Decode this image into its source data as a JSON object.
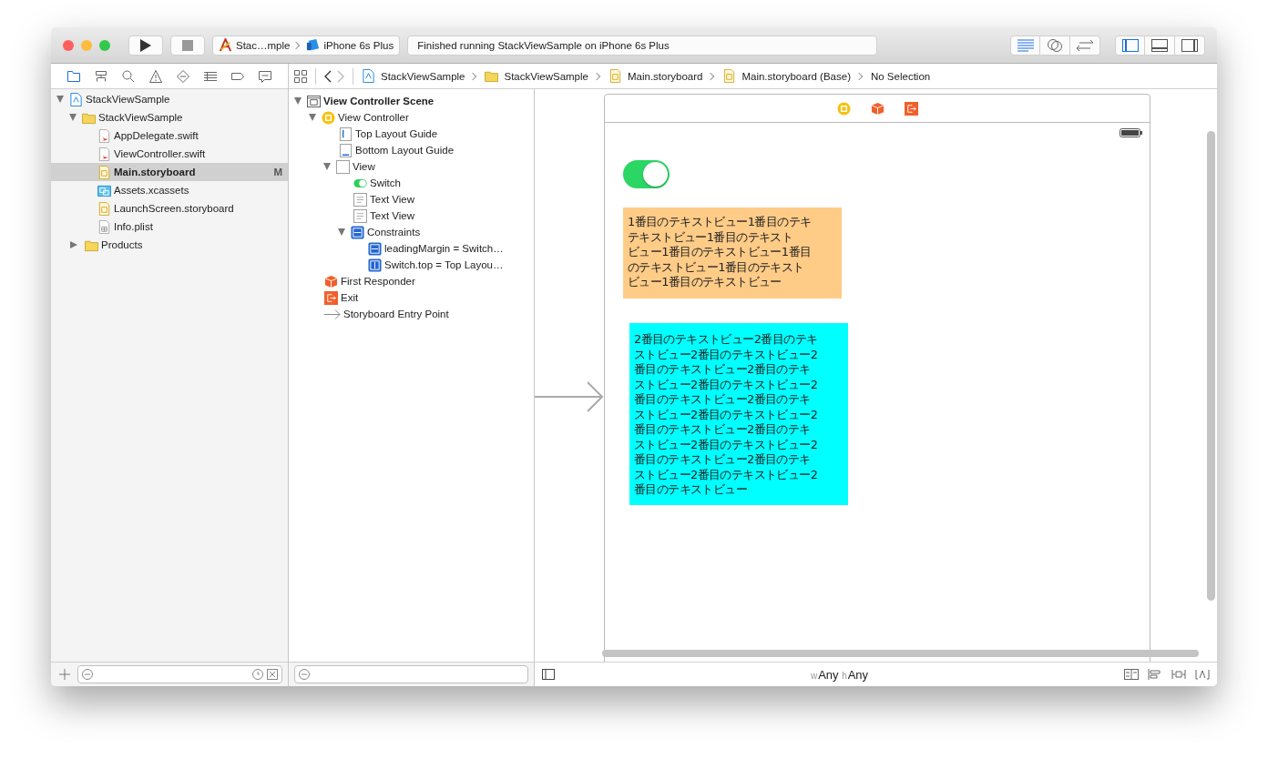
{
  "toolbar": {
    "scheme": {
      "target": "Stac…mple",
      "device": "iPhone 6s Plus"
    },
    "activity": "Finished running StackViewSample on iPhone 6s Plus",
    "editor_modes": [
      {
        "kind": "standard",
        "selected": true
      },
      {
        "kind": "assistant",
        "selected": false
      },
      {
        "kind": "version",
        "selected": false
      }
    ],
    "view_toggles": [
      {
        "kind": "navigator",
        "selected": true
      },
      {
        "kind": "debug",
        "selected": false
      },
      {
        "kind": "utilities",
        "selected": false
      }
    ]
  },
  "navigator_tabs": [
    {
      "kind": "folder",
      "selected": true
    },
    {
      "kind": "hierarchy",
      "selected": false
    },
    {
      "kind": "search",
      "selected": false
    },
    {
      "kind": "warning",
      "selected": false
    },
    {
      "kind": "test",
      "selected": false
    },
    {
      "kind": "debug",
      "selected": false
    },
    {
      "kind": "breakpoint",
      "selected": false
    },
    {
      "kind": "report",
      "selected": false
    }
  ],
  "jump_bar": {
    "back_enabled": true,
    "forward_enabled": false,
    "path": [
      {
        "kind": "project",
        "label": "StackViewSample"
      },
      {
        "kind": "folder",
        "label": "StackViewSample"
      },
      {
        "kind": "storyboard",
        "label": "Main.storyboard"
      },
      {
        "kind": "storyboard",
        "label": "Main.storyboard (Base)"
      },
      {
        "kind": "none",
        "label": "No Selection"
      }
    ]
  },
  "navigator": {
    "items": [
      {
        "kind": "project",
        "label": "StackViewSample",
        "selected": false,
        "expanded": true,
        "children": [
          {
            "kind": "folder",
            "label": "StackViewSample",
            "selected": false,
            "expanded": true,
            "children": [
              {
                "kind": "swift",
                "label": "AppDelegate.swift",
                "selected": false
              },
              {
                "kind": "swift",
                "label": "ViewController.swift",
                "selected": false
              },
              {
                "kind": "storyboard",
                "label": "Main.storyboard",
                "selected": true,
                "badge": "M"
              },
              {
                "kind": "assets",
                "label": "Assets.xcassets",
                "selected": false
              },
              {
                "kind": "storyboard",
                "label": "LaunchScreen.storyboard",
                "selected": false
              },
              {
                "kind": "plist",
                "label": "Info.plist",
                "selected": false
              }
            ]
          },
          {
            "kind": "folder",
            "label": "Products",
            "selected": false,
            "expanded": false
          }
        ]
      }
    ]
  },
  "outline": {
    "items": [
      {
        "kind": "scene",
        "label": "View Controller Scene",
        "expanded": true,
        "children": [
          {
            "kind": "controller",
            "label": "View Controller",
            "expanded": true,
            "children": [
              {
                "kind": "top_guide",
                "label": "Top Layout Guide"
              },
              {
                "kind": "bottom_guide",
                "label": "Bottom Layout Guide"
              },
              {
                "kind": "view",
                "label": "View",
                "expanded": true,
                "children": [
                  {
                    "kind": "switch",
                    "label": "Switch"
                  },
                  {
                    "kind": "textview",
                    "label": "Text View"
                  },
                  {
                    "kind": "textview",
                    "label": "Text View"
                  },
                  {
                    "kind": "constraints",
                    "label": "Constraints",
                    "expanded": true,
                    "children": [
                      {
                        "kind": "h_constraint",
                        "label": "leadingMargin = Switch…"
                      },
                      {
                        "kind": "v_constraint",
                        "label": "Switch.top = Top Layou…"
                      }
                    ]
                  }
                ]
              }
            ]
          },
          {
            "kind": "responder",
            "label": "First Responder"
          },
          {
            "kind": "exit",
            "label": "Exit"
          },
          {
            "kind": "entry",
            "label": "Storyboard Entry Point"
          }
        ]
      }
    ]
  },
  "canvas": {
    "scene_dock": [
      {
        "kind": "controller"
      },
      {
        "kind": "responder"
      },
      {
        "kind": "exit"
      }
    ],
    "switch": {
      "on": true
    },
    "text_views": [
      {
        "color": "#ffcc88",
        "lines": [
          "1番目のテキストビュー1番目のテキ",
          "テキストビュー1番目のテキスト",
          "ビュー1番目のテキストビュー1番目",
          "のテキストビュー1番目のテキスト",
          "ビュー1番目のテキストビュー"
        ]
      },
      {
        "color": "#00ffff",
        "lines": [
          "2番目のテキストビュー2番目のテキ",
          "ストビュー2番目のテキストビュー2",
          "番目のテキストビュー2番目のテキ",
          "ストビュー2番目のテキストビュー2",
          "番目のテキストビュー2番目のテキ",
          "ストビュー2番目のテキストビュー2",
          "番目のテキストビュー2番目のテキ",
          "ストビュー2番目のテキストビュー2",
          "番目のテキストビュー2番目のテキ",
          "ストビュー2番目のテキストビュー2",
          "番目のテキストビュー"
        ]
      }
    ]
  },
  "size_class": {
    "w_label": "w",
    "w_value": "Any",
    "h_label": "h",
    "h_value": "Any"
  }
}
